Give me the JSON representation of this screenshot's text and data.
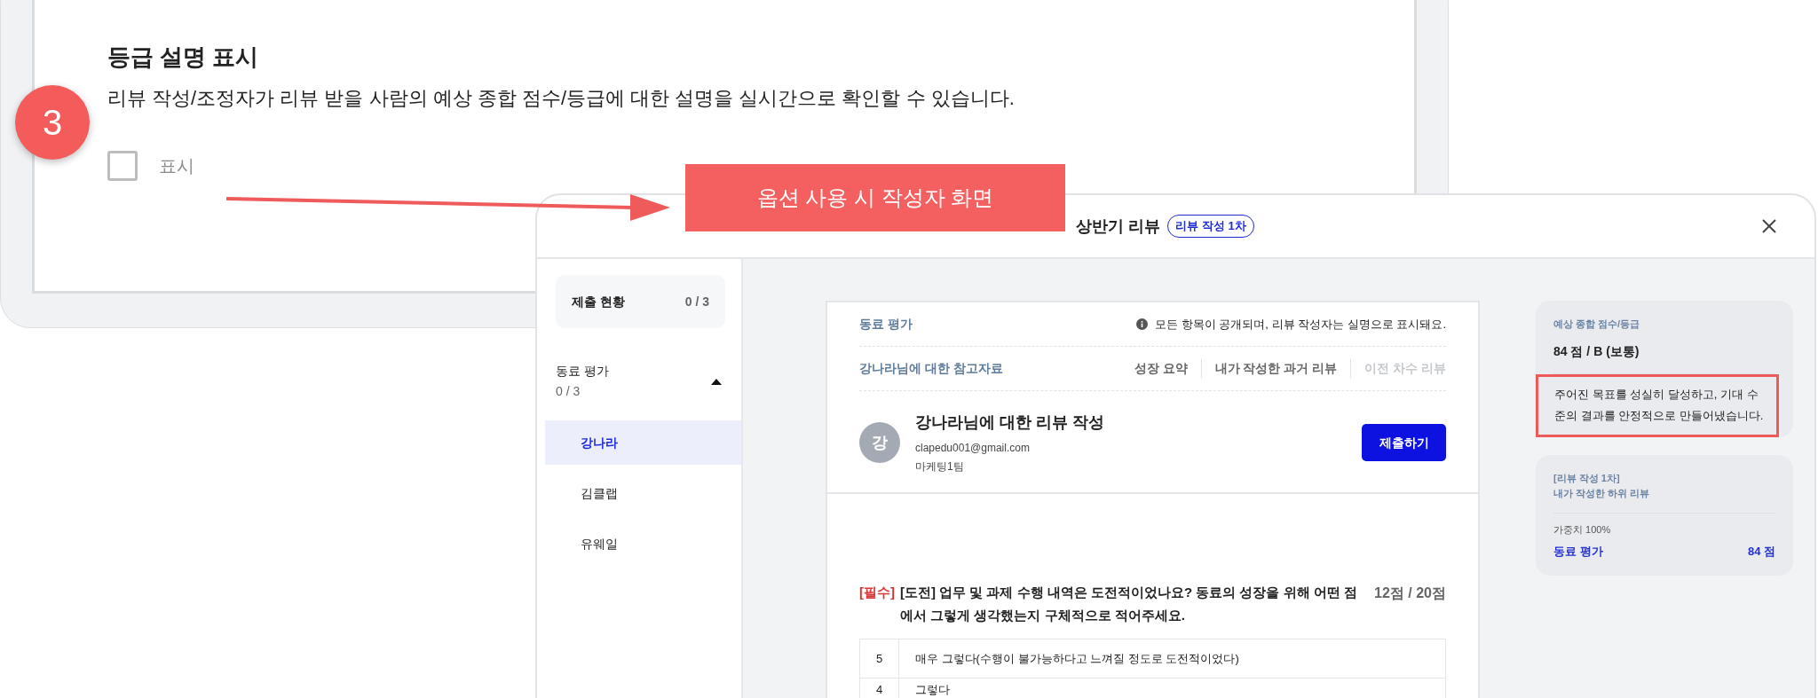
{
  "section": {
    "step": "3",
    "title": "등급 설명 표시",
    "description": "리뷰 작성/조정자가 리뷰 받을 사람의 예상 종합 점수/등급에 대한 설명을 실시간으로 확인할 수 있습니다.",
    "option": {
      "label": "표시",
      "checked": false
    }
  },
  "callout": {
    "label": "옵션 사용 시 작성자 화면"
  },
  "modal": {
    "title": "상반기 리뷰",
    "badge": "리뷰 작성 1차",
    "sidebar": {
      "summary": {
        "label": "제출 현황",
        "count": "0 / 3"
      },
      "groups": [
        {
          "label": "동료 평가",
          "count": "0 / 3",
          "expanded": true,
          "items": [
            {
              "name": "강나라",
              "selected": true
            },
            {
              "name": "김클랩",
              "selected": false
            },
            {
              "name": "유웨일",
              "selected": false
            }
          ]
        }
      ]
    },
    "form": {
      "section": "동료 평가",
      "notice": "모든 항목이 공개되며, 리뷰 작성자는 실명으로 표시돼요.",
      "references_title": "강나라님에 대한 참고자료",
      "reference_links": [
        {
          "label": "성장 요약",
          "disabled": false
        },
        {
          "label": "내가 작성한 과거 리뷰",
          "disabled": false
        },
        {
          "label": "이전 차수 리뷰",
          "disabled": true
        }
      ],
      "reviewee": {
        "initial": "강",
        "title": "강나라님에 대한 리뷰 작성",
        "email": "clapedu001@gmail.com",
        "team": "마케팅1팀"
      },
      "submit": "제출하기",
      "question": {
        "required": "[필수]",
        "text": "[도전] 업무 및 과제 수행 내역은 도전적이었나요? 동료의 성장을 위해 어떤 점에서 그렇게 생각했는지 구체적으로 적어주세요.",
        "score": "12점 / 20점",
        "options": [
          {
            "value": "5",
            "label": "매우 그렇다(수행이 불가능하다고 느껴질 정도로 도전적이었다)"
          },
          {
            "value": "4",
            "label": "그렇다"
          }
        ]
      }
    },
    "grade_panel": {
      "label": "예상 종합 점수/등급",
      "score": "84 점 / B (보통)",
      "description": "주어진 목표를 성실히 달성하고, 기대 수준의 결과를 안정적으로 만들어냈습니다.",
      "highlighted": true
    },
    "my_review": {
      "round": "[리뷰 작성 1차]",
      "title": "내가 작성한 하위 리뷰",
      "weight": "가중치 100%",
      "category": "동료 평가",
      "score": "84 점"
    }
  }
}
